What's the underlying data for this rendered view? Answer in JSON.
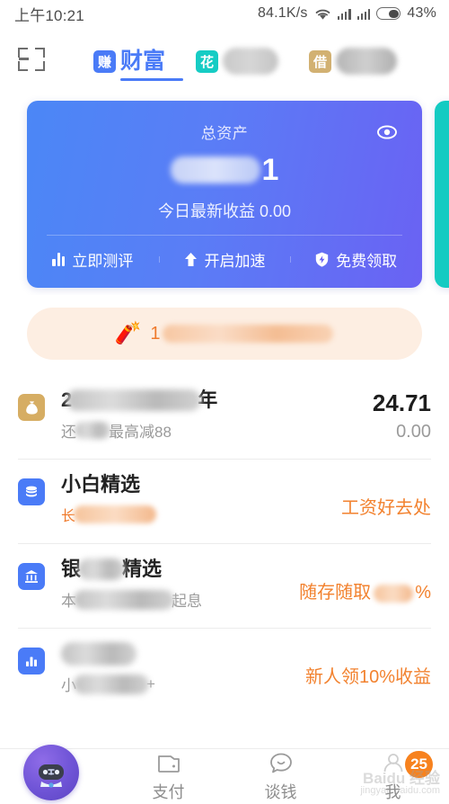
{
  "status_bar": {
    "time": "上午10:21",
    "network_speed": "84.1K/s",
    "wifi_icon": "wifi-icon",
    "signal_icon_1": "signal-bars-icon",
    "signal_icon_2": "signal-bars-icon",
    "battery_icon": "battery-icon",
    "battery_percent": "43%"
  },
  "top_nav": {
    "scan_icon": "scan-qr-icon",
    "tabs": [
      {
        "badge": "赚",
        "badge_color": "#4a7bf7",
        "label": "财富",
        "active": true
      },
      {
        "badge": "花",
        "badge_color": "#16ccc4",
        "label": "",
        "active": false
      },
      {
        "badge": "借",
        "badge_color": "#d2b172",
        "label": "",
        "active": false
      }
    ]
  },
  "asset_card": {
    "title": "总资产",
    "eye_icon": "eye-icon",
    "amount_visible_tail": "1",
    "today_profit": "今日最新收益 0.00",
    "actions": [
      {
        "icon": "bar-chart-icon",
        "label": "立即测评"
      },
      {
        "icon": "arrow-up-icon",
        "label": "开启加速"
      },
      {
        "icon": "shield-icon",
        "label": "免费领取"
      }
    ]
  },
  "promo_banner": {
    "emoji_icon": "firecracker-icon",
    "prefix": "1"
  },
  "product_list": [
    {
      "icon": "money-bag-icon",
      "icon_color": "#d6ad63",
      "title_prefix": "2",
      "title_suffix": "年",
      "subtitle_suffix": "最高减88",
      "subtitle_prefix": "还",
      "value": "24.71",
      "value_sub": "0.00",
      "tag": ""
    },
    {
      "icon": "coins-stack-icon",
      "icon_color": "#4a7bf7",
      "title": "小白精选",
      "subtitle_prefix": "长",
      "tag": "工资好去处",
      "value": "",
      "value_sub": ""
    },
    {
      "icon": "bank-icon",
      "icon_color": "#4a7bf7",
      "title_prefix": "银",
      "title_suffix": "精选",
      "subtitle_prefix": "本",
      "subtitle_suffix": "起息",
      "tag_prefix": "随存随取",
      "tag_suffix": "%",
      "value": "",
      "value_sub": ""
    },
    {
      "icon": "bar-chart-icon",
      "icon_color": "#4a7bf7",
      "title": "",
      "subtitle_prefix": "小",
      "subtitle_suffix": "+",
      "tag": "新人领10%收益",
      "value": "",
      "value_sub": ""
    }
  ],
  "bottom_nav": {
    "mascot_icon": "mascot-avatar-icon",
    "items": [
      {
        "icon": "wallet-icon",
        "label": "支付"
      },
      {
        "icon": "chat-icon",
        "label": "谈钱"
      },
      {
        "icon": "person-icon",
        "label": "我",
        "badge": "25"
      }
    ]
  },
  "watermark": {
    "line1": "Baidu 经验",
    "line2": "jingyan.baidu.com"
  }
}
